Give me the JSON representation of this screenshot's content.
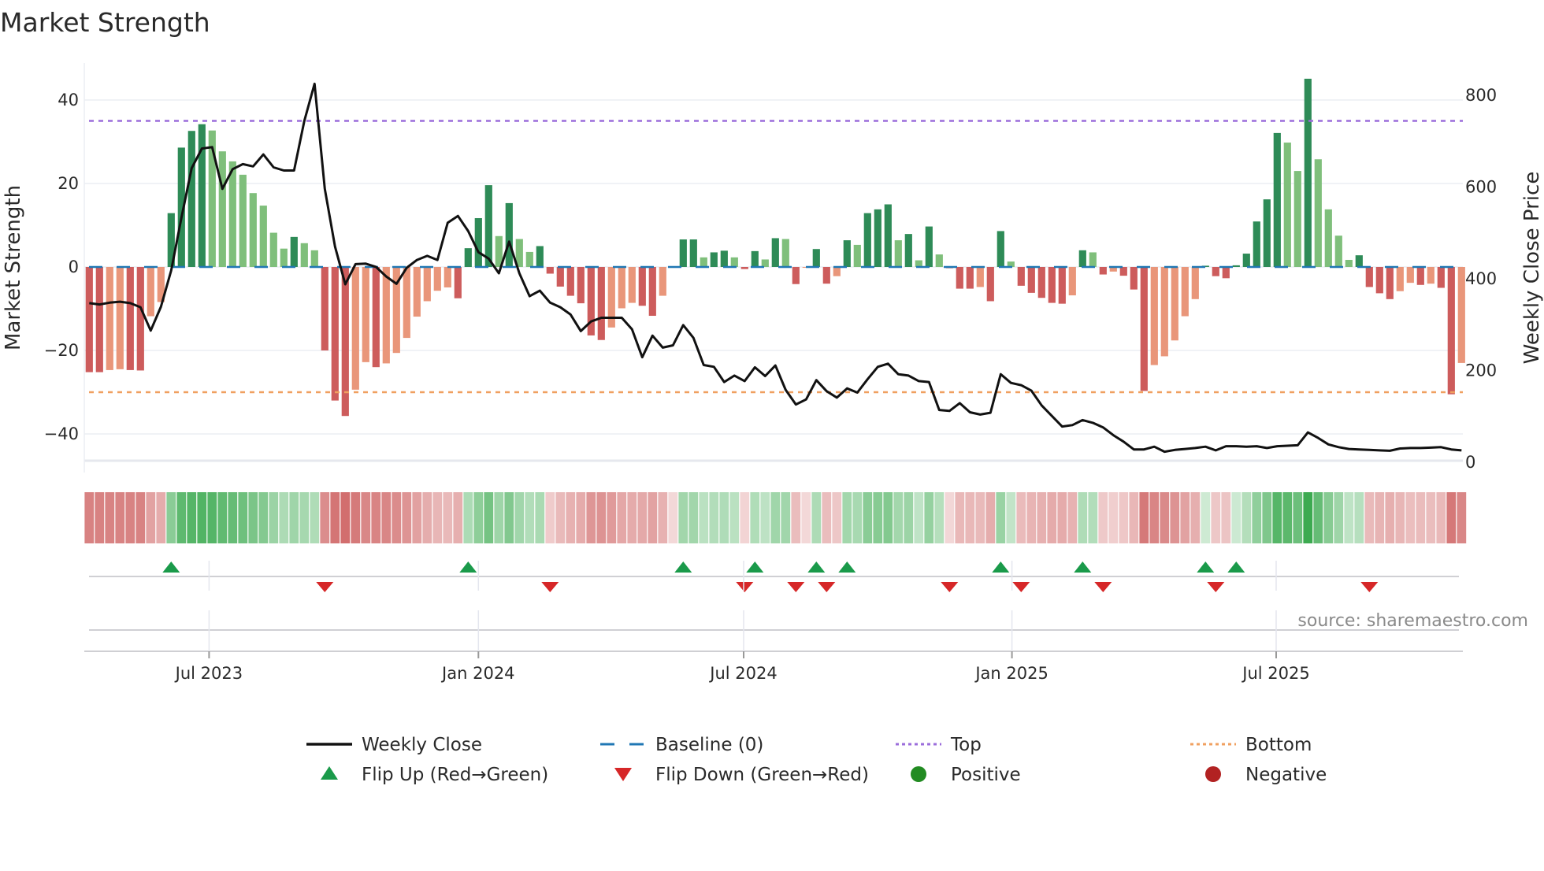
{
  "title": "Market Strength",
  "source": "source: sharemaestro.com",
  "colors": {
    "strong_positive": "#2e8b57",
    "weak_positive": "#7fbf7b",
    "strong_negative": "#cd5c5c",
    "weak_negative": "#e9967a",
    "baseline": "#1f77b4",
    "top": "#9b6ddb",
    "bottom": "#f0a060",
    "flip_up": "#1a9a4a",
    "flip_down": "#d62728",
    "positive_dot": "#228b22",
    "negative_dot": "#b22222"
  },
  "legend": [
    {
      "label": "Weekly Close",
      "kind": "line"
    },
    {
      "label": "Baseline (0)",
      "kind": "dash"
    },
    {
      "label": "Top",
      "kind": "dot-top"
    },
    {
      "label": "Bottom",
      "kind": "dot-bottom"
    },
    {
      "label": "Flip Up (Red→Green)",
      "kind": "tri-up"
    },
    {
      "label": "Flip Down (Green→Red)",
      "kind": "tri-down"
    },
    {
      "label": "Positive",
      "kind": "dot-pos"
    },
    {
      "label": "Negative",
      "kind": "dot-neg"
    }
  ],
  "chart_data": {
    "type": "bar",
    "title": "Market Strength",
    "ylabel": "Market Strength",
    "y2label": "Weekly Close Price",
    "ylim": [
      -47,
      47
    ],
    "y2lim": [
      0,
      860
    ],
    "yticks": [
      40,
      20,
      0,
      -20,
      -40
    ],
    "ytick_labels": [
      "40",
      "20",
      "0",
      "−20",
      "−40"
    ],
    "y2ticks": [
      800,
      600,
      400,
      200,
      0
    ],
    "y2tick_labels": [
      "800",
      "600",
      "400",
      "200",
      "0"
    ],
    "top_level": 35,
    "bottom_level": -30,
    "baseline": 0,
    "x_unit": "week index",
    "xticks": [
      {
        "label": "Jul 2023",
        "week": 11.7
      },
      {
        "label": "Jan 2024",
        "week": 38.0
      },
      {
        "label": "Jul 2024",
        "week": 63.9
      },
      {
        "label": "Jan 2025",
        "week": 90.1
      },
      {
        "label": "Jul 2025",
        "week": 115.9
      }
    ],
    "strength": [
      -25.2,
      -25.2,
      -24.7,
      -24.5,
      -24.7,
      -24.8,
      -11.8,
      -8.4,
      12.9,
      28.6,
      32.6,
      34.2,
      32.7,
      27.7,
      25.3,
      22.1,
      17.7,
      14.7,
      8.2,
      4.4,
      7.2,
      5.7,
      4.0,
      -20,
      -32,
      -35.7,
      -29.4,
      -22.8,
      -24,
      -23.1,
      -20.6,
      -17,
      -11.9,
      -8.2,
      -5.7,
      -4.9,
      -7.5,
      4.5,
      11.7,
      19.6,
      7.4,
      15.3,
      6.7,
      3.6,
      5,
      -1.6,
      -4.7,
      -6.9,
      -8.7,
      -16.4,
      -17.5,
      -14.5,
      -9.9,
      -8.6,
      -9.3,
      -11.7,
      -6.9,
      -0.2,
      6.6,
      6.6,
      2.3,
      3.5,
      3.9,
      2.3,
      -0.5,
      3.8,
      1.8,
      6.9,
      6.7,
      -4.1,
      -0.2,
      4.3,
      -4,
      -2.2,
      6.4,
      5.3,
      12.9,
      13.8,
      15,
      6.4,
      7.9,
      1.6,
      9.7,
      3,
      -0.3,
      -5.2,
      -5.2,
      -4.8,
      -8.2,
      8.6,
      1.3,
      -4.5,
      -6.2,
      -7.4,
      -8.6,
      -8.8,
      -6.8,
      4,
      3.5,
      -1.8,
      -1.1,
      -2.1,
      -5.4,
      -29.7,
      -23.5,
      -21.4,
      -17.6,
      -11.8,
      -7.7,
      0.3,
      -2.2,
      -2.7,
      0.4,
      3.2,
      10.9,
      16.2,
      32.1,
      29.8,
      23,
      45.1,
      25.8,
      13.8,
      7.5,
      1.7,
      2.8,
      -4.8,
      -6.3,
      -7.7,
      -5.8,
      -3.8,
      -4.3,
      -4,
      -5,
      -30.5,
      -23
    ],
    "close": [
      347,
      344,
      348,
      350,
      347,
      338,
      287,
      339,
      418,
      533,
      641,
      684,
      687,
      596,
      639,
      650,
      645,
      671,
      643,
      636,
      636,
      744,
      825,
      596,
      470,
      388,
      432,
      433,
      426,
      405,
      389,
      424,
      441,
      450,
      441,
      522,
      537,
      504,
      458,
      444,
      412,
      481,
      412,
      362,
      374,
      348,
      338,
      322,
      286,
      307,
      315,
      315,
      315,
      290,
      229,
      276,
      250,
      255,
      299,
      271,
      212,
      208,
      175,
      189,
      177,
      207,
      188,
      211,
      158,
      126,
      137,
      179,
      155,
      141,
      161,
      152,
      181,
      208,
      215,
      192,
      189,
      177,
      175,
      114,
      112,
      129,
      109,
      104,
      108,
      192,
      173,
      168,
      156,
      124,
      101,
      78,
      81,
      92,
      86,
      76,
      59,
      45,
      28,
      28,
      34,
      23,
      27,
      29,
      31,
      34,
      26,
      35,
      35,
      34,
      35,
      31,
      35,
      36,
      37,
      65,
      53,
      39,
      33,
      29,
      28,
      27,
      26,
      25,
      30,
      31,
      31,
      32,
      33,
      28,
      26
    ]
  }
}
